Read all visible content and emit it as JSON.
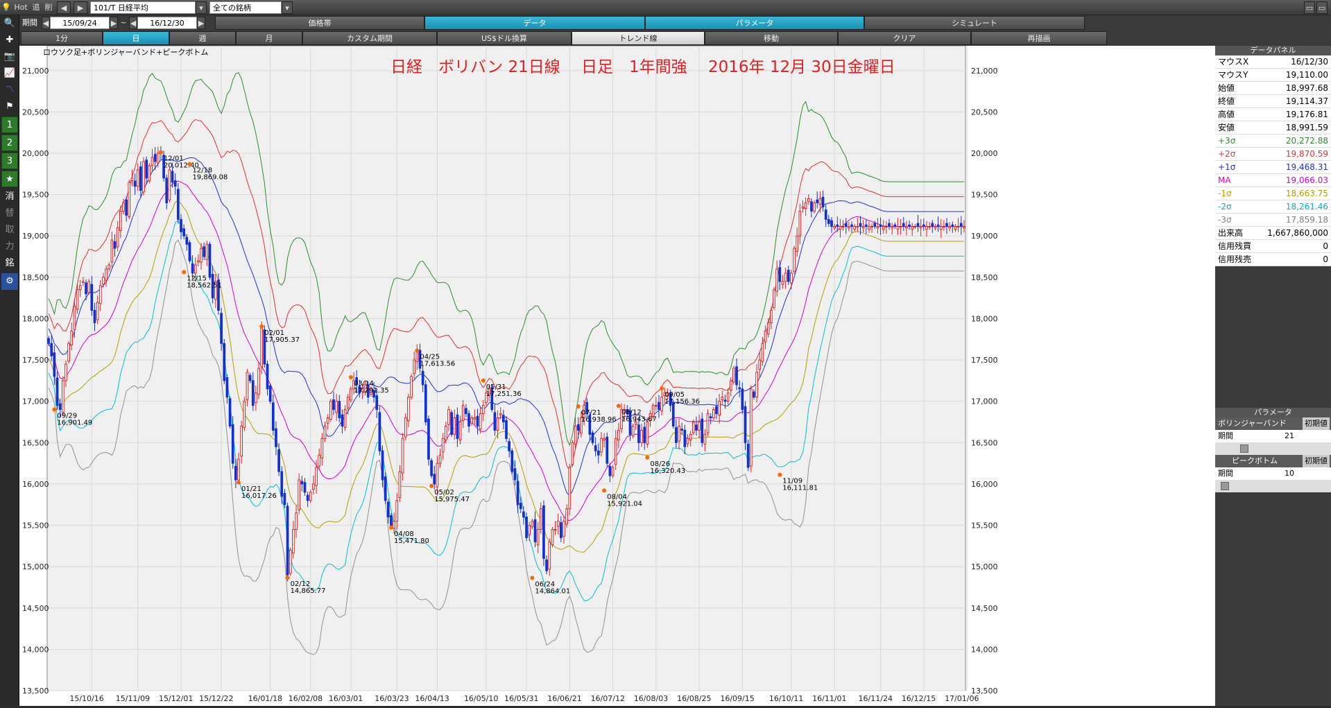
{
  "toolbar": {
    "hot": "Hot",
    "tsui": "追",
    "sakujo": "削",
    "symbol": "101/T 日経平均",
    "universe": "全ての銘柄",
    "period_label": "期間",
    "start_date": "15/09/24",
    "tilde": "~",
    "end_date": "16/12/30",
    "tabs": [
      {
        "label": "価格帯"
      },
      {
        "label": "データ"
      },
      {
        "label": "パラメータ"
      },
      {
        "label": "シミュレート"
      }
    ],
    "row3": [
      {
        "label": "1分"
      },
      {
        "label": "日"
      },
      {
        "label": "週"
      },
      {
        "label": "月"
      },
      {
        "label": "カスタム期間"
      },
      {
        "label": "US$ドル換算"
      },
      {
        "label": "トレンド線"
      },
      {
        "label": "移動"
      },
      {
        "label": "クリア"
      },
      {
        "label": "再描画"
      }
    ]
  },
  "leftbar": {
    "items": [
      {
        "label": "1"
      },
      {
        "label": "2"
      },
      {
        "label": "3"
      },
      {
        "label": "★"
      },
      {
        "label": "消"
      },
      {
        "label": "替"
      },
      {
        "label": "取"
      },
      {
        "label": "力"
      },
      {
        "label": "銘"
      },
      {
        "label": "⚙"
      }
    ]
  },
  "chart_data": {
    "type": "candlestick",
    "chart_caption": "ロウソク足+ボリンジャーバンド+ピークボトム",
    "title": "日経　ボリバン 21日線　 日足　1年間強　 2016年 12月  30日金曜日",
    "ylim": [
      13500,
      21300
    ],
    "y_ticks": [
      "21,000",
      "20,500",
      "20,000",
      "19,500",
      "19,000",
      "18,500",
      "18,000",
      "17,500",
      "17,000",
      "16,500",
      "16,000",
      "15,500",
      "15,000",
      "14,500",
      "14,000",
      "13,500"
    ],
    "y_tick_values": [
      21000,
      20500,
      20000,
      19500,
      19000,
      18500,
      18000,
      17500,
      17000,
      16500,
      16000,
      15500,
      15000,
      14500,
      14000,
      13500
    ],
    "x_tick_labels": [
      "15/10/16",
      "15/11/09",
      "15/12/01",
      "15/12/22",
      "16/01/18",
      "16/02/08",
      "16/03/01",
      "16/03/23",
      "16/04/13",
      "16/05/10",
      "16/05/31",
      "16/06/21",
      "16/07/12",
      "16/08/03",
      "16/08/25",
      "16/09/15",
      "16/10/11",
      "16/11/01",
      "16/11/24",
      "16/12/15",
      "17/01/06"
    ],
    "x_tick_index": [
      15,
      31,
      46,
      60,
      77,
      91,
      105,
      121,
      135,
      152,
      166,
      181,
      196,
      211,
      226,
      241,
      258,
      273,
      289,
      304,
      319
    ],
    "n_bars": 319,
    "close": [
      17700,
      17550,
      17300,
      16950,
      16900,
      17250,
      17450,
      17700,
      17850,
      18150,
      18350,
      18400,
      18450,
      18300,
      18450,
      18100,
      17950,
      18200,
      18400,
      18500,
      18600,
      18650,
      18950,
      18850,
      19100,
      19300,
      19400,
      19250,
      19650,
      19700,
      19600,
      19800,
      19550,
      19900,
      19700,
      19850,
      19950,
      19900,
      20000,
      20012,
      19700,
      19400,
      19800,
      19650,
      19600,
      19200,
      19050,
      19000,
      18900,
      18700,
      18550,
      18650,
      18700,
      18850,
      18750,
      18900,
      18500,
      18250,
      18450,
      18100,
      17700,
      17250,
      17050,
      16700,
      16250,
      16050,
      16300,
      16700,
      17000,
      17350,
      17250,
      16950,
      17100,
      17400,
      17900,
      17450,
      17150,
      17000,
      16650,
      16450,
      16150,
      15850,
      15750,
      14900,
      15200,
      15450,
      15650,
      16050,
      16000,
      15900,
      15800,
      15900,
      16000,
      16200,
      16350,
      16550,
      16700,
      16800,
      17000,
      16900,
      17000,
      16800,
      16700,
      16900,
      17050,
      17150,
      17250,
      17200,
      17100,
      17150,
      17200,
      17050,
      17150,
      17050,
      16900,
      16400,
      16050,
      15800,
      15600,
      15500,
      15550,
      15800,
      16150,
      16550,
      16800,
      17050,
      17300,
      17500,
      17600,
      17400,
      17200,
      16750,
      16300,
      16100,
      16000,
      16250,
      16350,
      16550,
      16700,
      16900,
      16600,
      16800,
      16550,
      16750,
      16950,
      16850,
      16700,
      16800,
      16800,
      16700,
      16850,
      16950,
      17100,
      17150,
      16900,
      16650,
      16800,
      16850,
      16750,
      16550,
      16400,
      16150,
      16050,
      15750,
      15700,
      15600,
      15350,
      15500,
      15550,
      15300,
      15450,
      15700,
      15100,
      14950,
      15300,
      15450,
      15450,
      15550,
      15350,
      15550,
      15700,
      16200,
      16500,
      16700,
      16650,
      16800,
      16950,
      16850,
      16600,
      16500,
      16400,
      16350,
      16550,
      16550,
      16250,
      16100,
      16200,
      16550,
      16650,
      16900,
      16900,
      16850,
      16600,
      16700,
      16750,
      16500,
      16650,
      16500,
      16750,
      16850,
      16950,
      16950,
      16900,
      17050,
      17100,
      17100,
      16950,
      16700,
      16500,
      16700,
      16650,
      16450,
      16550,
      16600,
      16750,
      16650,
      16750,
      16500,
      16600,
      16850,
      16800,
      16900,
      16850,
      17000,
      17050,
      17000,
      17100,
      17250,
      17400,
      17200,
      17150,
      16900,
      16500,
      16200,
      17150,
      17050,
      17350,
      17500,
      17700,
      17850,
      17950,
      18100,
      18350,
      18600,
      18450,
      18450,
      18550,
      18450,
      18550,
      18850,
      19000,
      19300,
      19350,
      19400,
      19450,
      19300,
      19400,
      19400,
      19450,
      19350,
      19200,
      19150,
      19115
    ],
    "series": [],
    "peaks": [
      {
        "date": "09/29",
        "value": "16,901.49",
        "i": 2,
        "y": 16901
      },
      {
        "date": "12/01",
        "value": "20,012.40",
        "i": 39,
        "y": 20012
      },
      {
        "date": "12/18",
        "value": "19,869.08",
        "i": 49,
        "y": 19869
      },
      {
        "date": "12/15",
        "value": "18,562.51",
        "i": 47,
        "y": 18563
      },
      {
        "date": "02/01",
        "value": "17,905.37",
        "i": 74,
        "y": 17905
      },
      {
        "date": "01/21",
        "value": "16,017.26",
        "i": 66,
        "y": 16017
      },
      {
        "date": "02/12",
        "value": "14,865.77",
        "i": 83,
        "y": 14866
      },
      {
        "date": "03/14",
        "value": "17,291.35",
        "i": 105,
        "y": 17291
      },
      {
        "date": "04/08",
        "value": "15,471.80",
        "i": 119,
        "y": 15472
      },
      {
        "date": "04/25",
        "value": "17,613.56",
        "i": 128,
        "y": 17614
      },
      {
        "date": "05/02",
        "value": "15,975.47",
        "i": 133,
        "y": 15975
      },
      {
        "date": "05/31",
        "value": "17,251.36",
        "i": 151,
        "y": 17251
      },
      {
        "date": "06/24",
        "value": "14,864.01",
        "i": 168,
        "y": 14864
      },
      {
        "date": "07/21",
        "value": "16,938.96",
        "i": 184,
        "y": 16939
      },
      {
        "date": "08/04",
        "value": "15,921.04",
        "i": 193,
        "y": 15921
      },
      {
        "date": "08/12",
        "value": "16,943.67",
        "i": 198,
        "y": 16944
      },
      {
        "date": "08/26",
        "value": "16,320.43",
        "i": 208,
        "y": 16320
      },
      {
        "date": "09/05",
        "value": "17,156.36",
        "i": 213,
        "y": 17156
      },
      {
        "date": "11/09",
        "value": "16,111.81",
        "i": 254,
        "y": 16112
      }
    ],
    "colors": {
      "up": "#e02020",
      "down": "#1030d0",
      "plus3": "#2e8b2e",
      "plus2": "#e03030",
      "plus1": "#2030d0",
      "ma": "#d000d0",
      "minus1": "#b0a000",
      "minus2": "#00c0d0",
      "minus3": "#909090",
      "title": "#e02020"
    }
  },
  "data_panel": {
    "header": "データパネル",
    "rows": [
      {
        "k": "マウスX",
        "v": "16/12/30",
        "color": "#000"
      },
      {
        "k": "マウスY",
        "v": "19,110.00",
        "color": "#000"
      },
      {
        "k": "始値",
        "v": "18,997.68",
        "color": "#000"
      },
      {
        "k": "終値",
        "v": "19,114.37",
        "color": "#000"
      },
      {
        "k": "高値",
        "v": "19,176.81",
        "color": "#000"
      },
      {
        "k": "安値",
        "v": "18,991.59",
        "color": "#000"
      },
      {
        "k": "+3σ",
        "v": "20,272.88",
        "color": "#2e8b2e"
      },
      {
        "k": "+2σ",
        "v": "19,870.59",
        "color": "#e03030"
      },
      {
        "k": "+1σ",
        "v": "19,468.31",
        "color": "#2030d0"
      },
      {
        "k": "MA",
        "v": "19,066.03",
        "color": "#d000d0"
      },
      {
        "k": "-1σ",
        "v": "18,663.75",
        "color": "#b0a000"
      },
      {
        "k": "-2σ",
        "v": "18,261.46",
        "color": "#00b0c0"
      },
      {
        "k": "-3σ",
        "v": "17,859.18",
        "color": "#808080"
      },
      {
        "k": "出来高",
        "v": "1,667,860,000",
        "color": "#000"
      },
      {
        "k": "信用残買",
        "v": "0",
        "color": "#000"
      },
      {
        "k": "信用残売",
        "v": "0",
        "color": "#000"
      }
    ]
  },
  "param_panel": {
    "header": "パラメータ",
    "boll_label": "ボリンジャーバンド",
    "init_label": "初期値",
    "period_label": "期間",
    "boll_period": "21",
    "peak_label": "ピークボトム",
    "peak_period": "10"
  }
}
